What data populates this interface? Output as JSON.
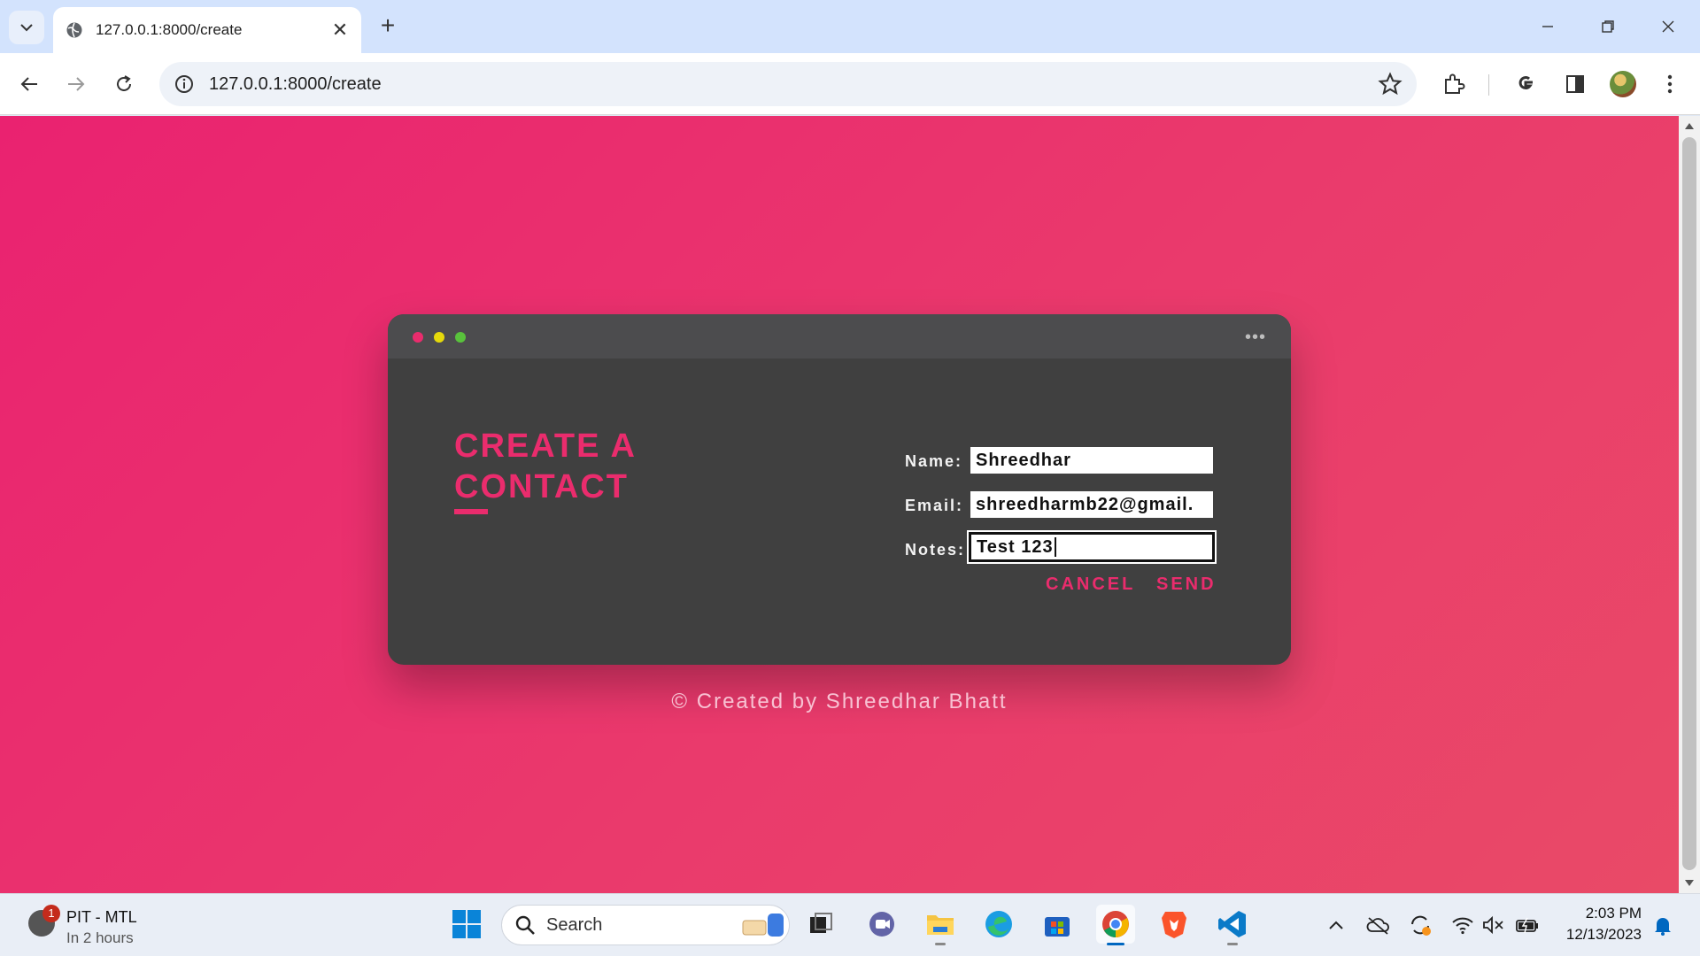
{
  "browser": {
    "tab_title": "127.0.0.1:8000/create",
    "url": "127.0.0.1:8000/create"
  },
  "form": {
    "heading": "CREATE A CONTACT",
    "fields": {
      "name_label": "Name:",
      "name_value": "Shreedhar",
      "email_label": "Email:",
      "email_value": "shreedharmb22@gmail.",
      "notes_label": "Notes:",
      "notes_value": "Test 123"
    },
    "cancel_label": "CANCEL",
    "send_label": "SEND",
    "window_dots": [
      "#ea2c6d",
      "#e5d90b",
      "#59c23c"
    ]
  },
  "footer": {
    "credit": "© Created by Shreedhar Bhatt"
  },
  "taskbar": {
    "weather_title": "PIT - MTL",
    "weather_subtitle": "In 2 hours",
    "weather_badge": "1",
    "search_label": "Search",
    "time": "2:03 PM",
    "date": "12/13/2023"
  },
  "colors": {
    "accent": "#ea2c6d",
    "card": "#404040",
    "page_gradient_start": "#ea2270",
    "page_gradient_end": "#e94a67"
  }
}
